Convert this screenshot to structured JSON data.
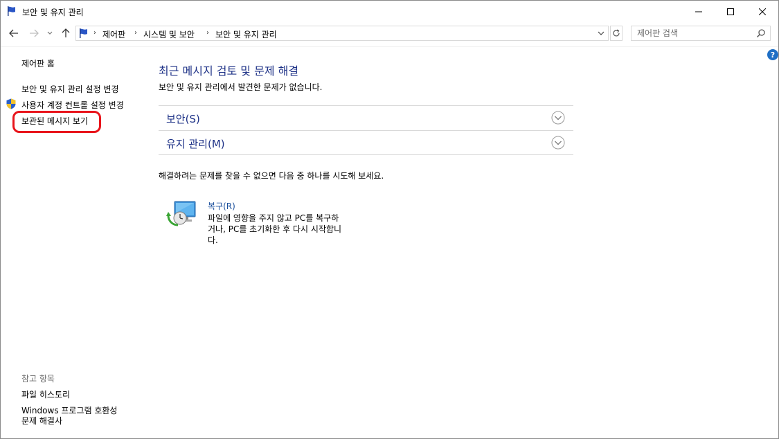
{
  "window": {
    "title": "보안 및 유지 관리"
  },
  "address_bar": {
    "crumbs": [
      "제어판",
      "시스템 및 보안",
      "보안 및 유지 관리"
    ],
    "separator": "›"
  },
  "search": {
    "placeholder": "제어판 검색"
  },
  "sidebar": {
    "home": "제어판 홈",
    "items": [
      "보안 및 유지 관리 설정 변경",
      "사용자 계정 컨트롤 설정 변경",
      "보관된 메시지 보기"
    ],
    "see_also_heading": "참고 항목",
    "see_also": [
      "파일 히스토리",
      "Windows 프로그램 호환성",
      "문제 해결사"
    ]
  },
  "main": {
    "title": "최근 메시지 검토 및 문제 해결",
    "subtitle": "보안 및 유지 관리에서 발견한 문제가 없습니다.",
    "sections": [
      "보안(S)",
      "유지 관리(M)"
    ],
    "hint": "해결하려는 문제를 찾을 수 없으면 다음 중 하나를 시도해 보세요.",
    "recovery": {
      "label": "복구(R)",
      "description": "파일에 영향을 주지 않고 PC를 복구하거나, PC를 초기화한 후 다시 시작합니다."
    }
  },
  "help_label": "?",
  "colors": {
    "link": "#1e3287",
    "highlight": "#e8141b",
    "help": "#1f6fc5"
  },
  "icons": [
    "flag-icon",
    "back-icon",
    "forward-icon",
    "recent-icon",
    "up-icon",
    "chevron-down-icon",
    "refresh-icon",
    "search-icon",
    "minimize-icon",
    "maximize-icon",
    "close-icon",
    "shield-icon",
    "expand-icon",
    "recovery-icon",
    "help-icon"
  ]
}
